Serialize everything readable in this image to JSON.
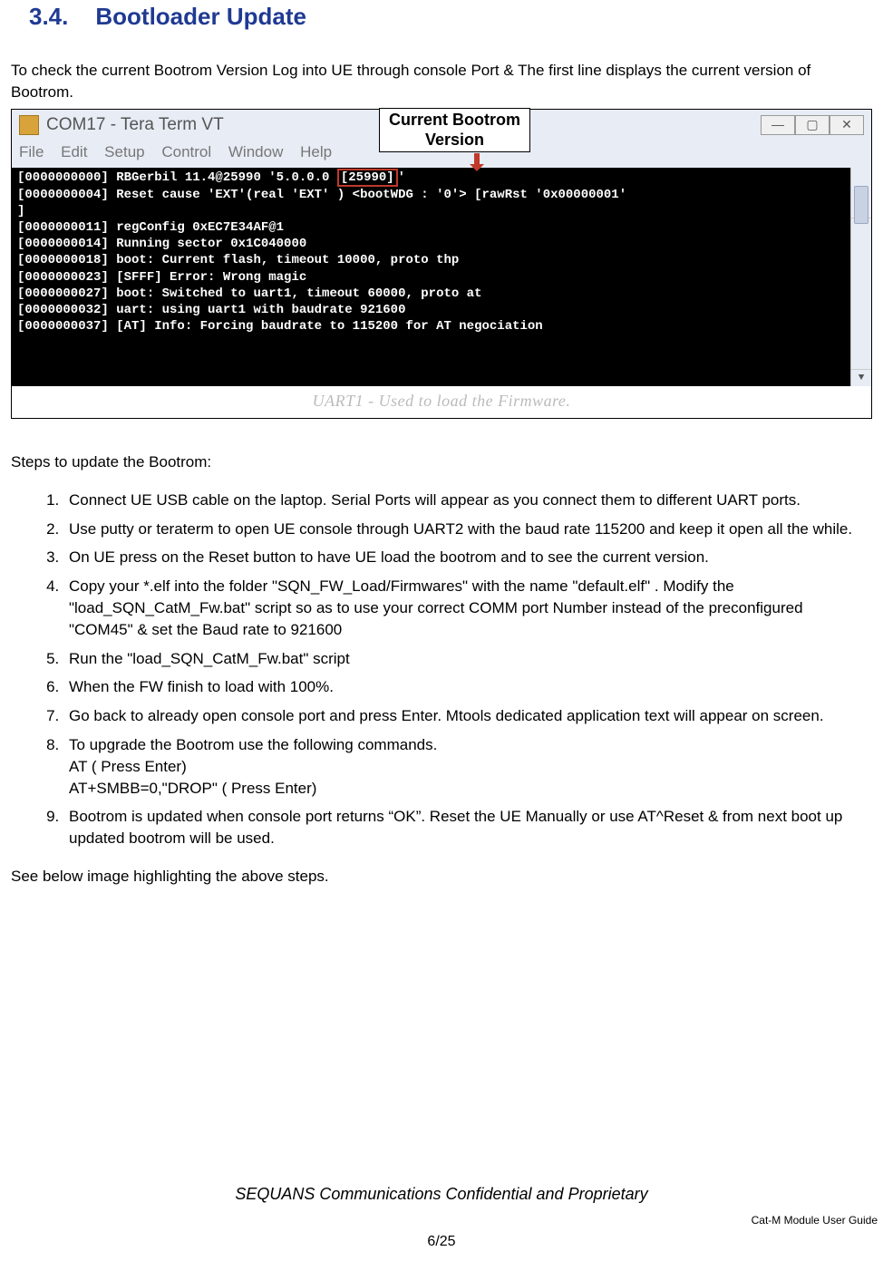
{
  "heading": {
    "number": "3.4.",
    "title": "Bootloader Update"
  },
  "intro": "To check the current Bootrom Version Log into UE through console Port & The first line displays the current version of Bootrom.",
  "figure": {
    "window_title": "COM17 - Tera Term VT",
    "callout_line1": "Current Bootrom",
    "callout_line2": "Version",
    "menu": [
      "File",
      "Edit",
      "Setup",
      "Control",
      "Window",
      "Help"
    ],
    "win_buttons": {
      "min": "—",
      "max": "▢",
      "close": "✕"
    },
    "console_lines": [
      {
        "ts": "[0000000000]",
        "pre": "RBGerbil 11.4@25990 '5.0.0.0 ",
        "hl": "[25990]",
        "post": "'"
      },
      {
        "ts": "[0000000004]",
        "pre": "Reset cause 'EXT'(real 'EXT' ) <bootWDG : '0'> [rawRst '0x00000001'",
        "hl": "",
        "post": ""
      },
      {
        "ts": "]",
        "pre": "",
        "hl": "",
        "post": ""
      },
      {
        "ts": "[0000000011]",
        "pre": "regConfig 0xEC7E34AF@1",
        "hl": "",
        "post": ""
      },
      {
        "ts": "[0000000014]",
        "pre": "Running sector 0x1C040000",
        "hl": "",
        "post": ""
      },
      {
        "ts": "[0000000018]",
        "pre": "boot: Current flash, timeout 10000, proto thp",
        "hl": "",
        "post": ""
      },
      {
        "ts": "[0000000023]",
        "pre": "[SFFF] Error: Wrong magic",
        "hl": "",
        "post": ""
      },
      {
        "ts": "[0000000027]",
        "pre": "boot: Switched to uart1, timeout 60000, proto at",
        "hl": "",
        "post": ""
      },
      {
        "ts": "[0000000032]",
        "pre": "uart: using uart1 with baudrate 921600",
        "hl": "",
        "post": ""
      },
      {
        "ts": "[0000000037]",
        "pre": "[AT] Info: Forcing baudrate to 115200 for AT negociation",
        "hl": "",
        "post": ""
      }
    ],
    "ghost_footer": "UART1 - Used to load the Firmware."
  },
  "steps_intro": "Steps to update the Bootrom:",
  "steps": [
    "Connect UE USB cable on the laptop. Serial Ports will appear as you connect them to different UART ports.",
    "Use putty or teraterm to open UE console through UART2 with the baud rate 115200 and keep it open all the while.",
    "On UE press on the Reset button to have UE load the bootrom and to see the current version.",
    "Copy your *.elf into the folder \"SQN_FW_Load/Firmwares\" with the name \"default.elf\" . Modify the \"load_SQN_CatM_Fw.bat\" script so as to use your correct COMM port Number instead of the preconfigured \"COM45\" & set the Baud rate to 921600",
    "Run the \"load_SQN_CatM_Fw.bat\" script",
    "When the FW finish to load with 100%.",
    "Go back to already open console port and press Enter. Mtools dedicated application text will appear on screen.",
    "To upgrade the Bootrom use the following commands.\nAT  ( Press Enter)\nAT+SMBB=0,\"DROP\"   ( Press Enter)",
    "Bootrom is updated when console port returns “OK”. Reset the UE Manually or use AT^Reset & from next boot up updated bootrom will be used."
  ],
  "closing": "See below image highlighting the above steps.",
  "footer": {
    "confidential": "SEQUANS Communications Confidential and Proprietary",
    "guide": "Cat-M Module User Guide",
    "page": "6/25"
  }
}
